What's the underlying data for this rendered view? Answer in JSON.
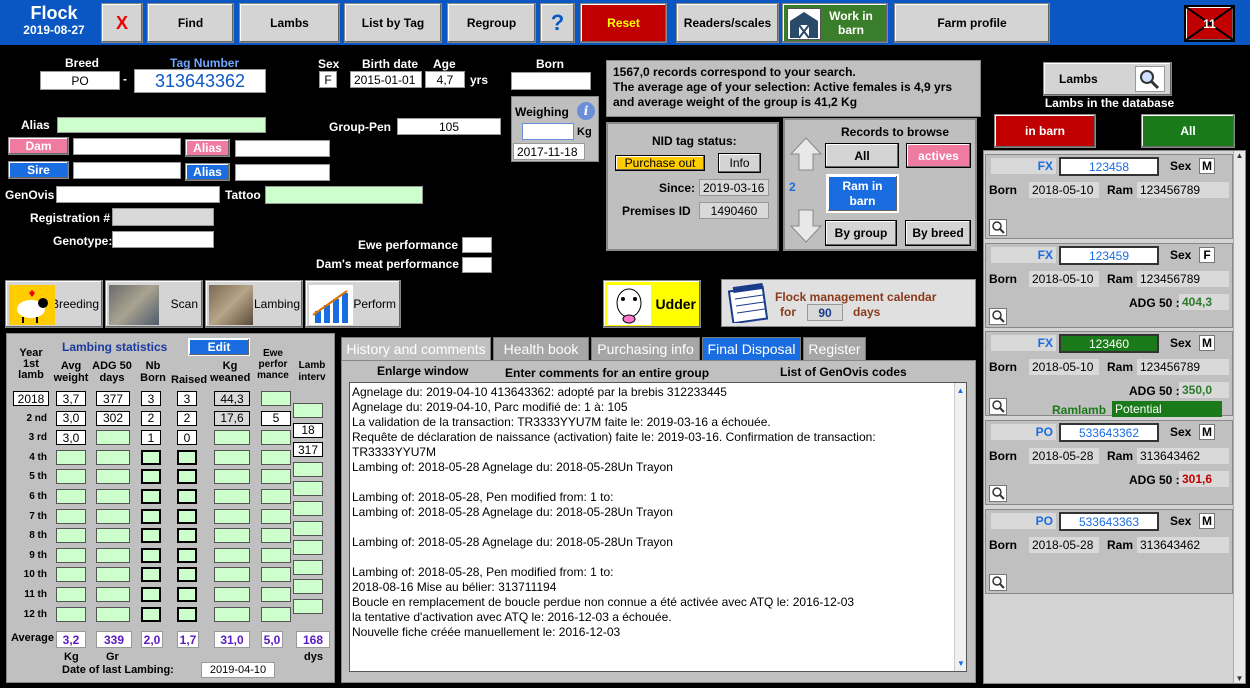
{
  "header": {
    "app": "Flock",
    "date": "2019-08-27",
    "close": "X",
    "find": "Find",
    "lambs": "Lambs",
    "list_by_tag": "List by Tag",
    "regroup": "Regroup",
    "help": "?",
    "reset": "Reset",
    "readers": "Readers/scales",
    "work_in_barn": "Work in barn",
    "farm_profile": "Farm profile",
    "count": "11"
  },
  "animal": {
    "breed_label": "Breed",
    "breed": "PO",
    "tag_label": "Tag Number",
    "tag": "313643362",
    "sex_label": "Sex",
    "sex": "F",
    "birth_label": "Birth date",
    "birth": "2015-01-01",
    "age_label": "Age",
    "age": "4,7",
    "yrs": "yrs",
    "born_label": "Born",
    "alias_label": "Alias",
    "group_pen_label": "Group-Pen",
    "group_pen": "105",
    "dam": "Dam",
    "sire": "Sire",
    "alias_btn": "Alias",
    "genovis": "GenOvis",
    "tattoo": "Tattoo",
    "registration": "Registration #",
    "genotype": "Genotype:",
    "ewe_perf": "Ewe performance",
    "dam_meat": "Dam's meat performance"
  },
  "weighing": {
    "title": "Weighing",
    "unit": "Kg",
    "date": "2017-11-18"
  },
  "summary": {
    "line1": "1567,0 records correspond to your search.",
    "line2": "The average age of your selection: Active females is 4,9 yrs and average weight of the group is 41,2 Kg"
  },
  "nid": {
    "title": "NID tag status:",
    "status": "Purchase out",
    "info": "Info",
    "since_label": "Since:",
    "since": "2019-03-16",
    "premises_label": "Premises ID",
    "premises": "1490460"
  },
  "browse": {
    "title": "Records to browse",
    "all": "All",
    "actives": "actives",
    "count": "2",
    "ram": "Ram in barn",
    "by_group": "By group",
    "by_breed": "By breed"
  },
  "modules": {
    "breeding": "Breeding",
    "scan": "Scan",
    "lambing": "Lambing",
    "perform": "Perform",
    "udder": "Udder",
    "calendar_title": "Flock management calendar",
    "for": "for",
    "days_value": "90",
    "days": "days"
  },
  "lambing": {
    "title": "Lambing statistics",
    "edit": "Edit",
    "headers": {
      "year": "Year 1st lamb",
      "avg": "Avg weight",
      "adg": "ADG 50 days",
      "nb": "Nb Born",
      "raised": "Raised",
      "kg": "Kg weaned",
      "ewe": "Ewe perfor mance",
      "interv": "Lamb interv"
    },
    "rows": [
      "1",
      "2 nd",
      "3 rd",
      "4 th",
      "5 th",
      "6 th",
      "7 th",
      "8 th",
      "9 th",
      "10 th",
      "11 th",
      "12 th"
    ],
    "r1": {
      "year": "2018",
      "avg": "3,7",
      "adg": "377",
      "nb": "3",
      "raised": "3",
      "kg": "44,3"
    },
    "r2": {
      "avg": "3,0",
      "adg": "302",
      "nb": "2",
      "raised": "2",
      "kg": "17,6",
      "ewe": "5",
      "interv": "18"
    },
    "r3": {
      "avg": "3,0",
      "nb": "1",
      "raised": "0",
      "interv": "317"
    },
    "avg_label": "Average",
    "avg": {
      "avg": "3,2",
      "adg": "339",
      "nb": "2,0",
      "raised": "1,7",
      "kg": "31,0",
      "ewe": "5,0",
      "interv": "168"
    },
    "units": {
      "kg": "Kg",
      "gr": "Gr",
      "dys": "dys"
    },
    "last_label": "Date of last Lambing:",
    "last": "2019-04-10"
  },
  "tabs": [
    "History and comments",
    "Health book",
    "Purchasing info",
    "Final Disposal",
    "Register"
  ],
  "comments": {
    "enlarge": "Enlarge window",
    "enter": "Enter comments for an entire group",
    "list": "List of GenOvis codes",
    "lines": [
      "Agnelage du: 2019-04-10  413643362:  adopté par  la brebis 312233445",
      "Agnelage du: 2019-04-10, Parc modifié de: 1 à: 105",
      "La validation de la transaction: TR3333YYU7M faite le: 2019-03-16 a échouée.",
      "Requête de déclaration de naissance (activation) faite le: 2019-03-16. Confirmation de transaction:",
      "TR3333YYU7M",
      "Lambing of: 2018-05-28  Agnelage du: 2018-05-28Un Trayon",
      "",
      "Lambing of: 2018-05-28, Pen modified from: 1 to:",
      "Lambing of: 2018-05-28  Agnelage du: 2018-05-28Un Trayon",
      "",
      "Lambing of: 2018-05-28  Agnelage du: 2018-05-28Un Trayon",
      "",
      "Lambing of: 2018-05-28, Pen modified from: 1 to:",
      "2018-08-16 Mise au bélier: 313711194",
      "Boucle en remplacement de boucle perdue non connue a été activée avec ATQ le: 2016-12-03",
      "la tentative d'activation avec ATQ le: 2016-12-03 a échouée.",
      "Nouvelle fiche créée manuellement le: 2016-12-03"
    ]
  },
  "lambs": {
    "title": "Lambs",
    "db": "Lambs in the database",
    "in_barn": "in barn",
    "all": "All",
    "cards": [
      {
        "breed": "FX",
        "tag": "123458",
        "sex": "M",
        "born": "2018-05-10",
        "ram": "123456789",
        "adg_label": "",
        "adg": "",
        "extra": ""
      },
      {
        "breed": "FX",
        "tag": "123459",
        "sex": "F",
        "born": "2018-05-10",
        "ram": "123456789",
        "adg_label": "ADG 50 :",
        "adg": "404,3",
        "extra": ""
      },
      {
        "breed": "FX",
        "tag": "123460",
        "sex": "M",
        "born": "2018-05-10",
        "ram": "123456789",
        "adg_label": "ADG 50 :",
        "adg": "350,0",
        "extra": "Ramlamb",
        "potential": "Potential"
      },
      {
        "breed": "PO",
        "tag": "533643362",
        "sex": "M",
        "born": "2018-05-28",
        "ram": "313643462",
        "adg_label": "ADG 50 :",
        "adg": "301,6",
        "extra": ""
      },
      {
        "breed": "PO",
        "tag": "533643363",
        "sex": "M",
        "born": "2018-05-28",
        "ram": "313643462",
        "adg_label": "",
        "adg": "",
        "extra": ""
      }
    ],
    "sex_label": "Sex",
    "born_label": "Born",
    "ram_label": "Ram"
  }
}
